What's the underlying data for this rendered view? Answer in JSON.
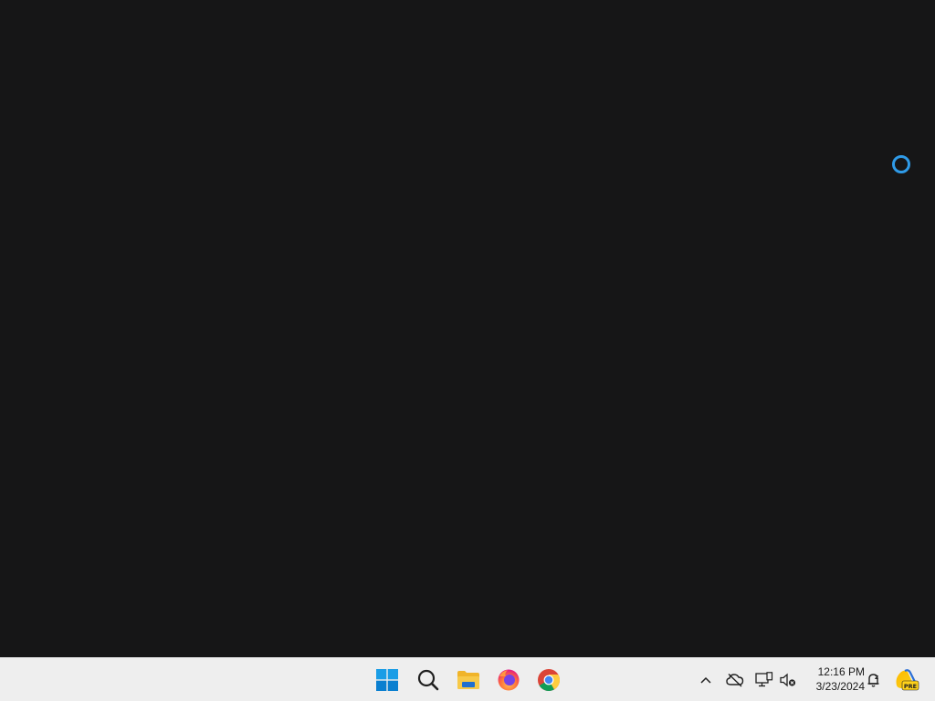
{
  "desktop": {
    "busy_indicator_color": "#2f9be8"
  },
  "taskbar": {
    "apps": [
      {
        "name": "Start",
        "icon": "windows-logo-icon"
      },
      {
        "name": "Search",
        "icon": "search-icon"
      },
      {
        "name": "File Explorer",
        "icon": "folder-icon"
      },
      {
        "name": "Firefox",
        "icon": "firefox-icon"
      },
      {
        "name": "Google Chrome",
        "icon": "chrome-icon"
      }
    ],
    "tray": {
      "icons": [
        "chevron-up-icon",
        "onedrive-offline-icon",
        "network-icon",
        "volume-muted-icon",
        "notification-icon",
        "copilot-pre-icon"
      ],
      "time": "12:16 PM",
      "date": "3/23/2024",
      "badge_text": "PRE"
    }
  }
}
